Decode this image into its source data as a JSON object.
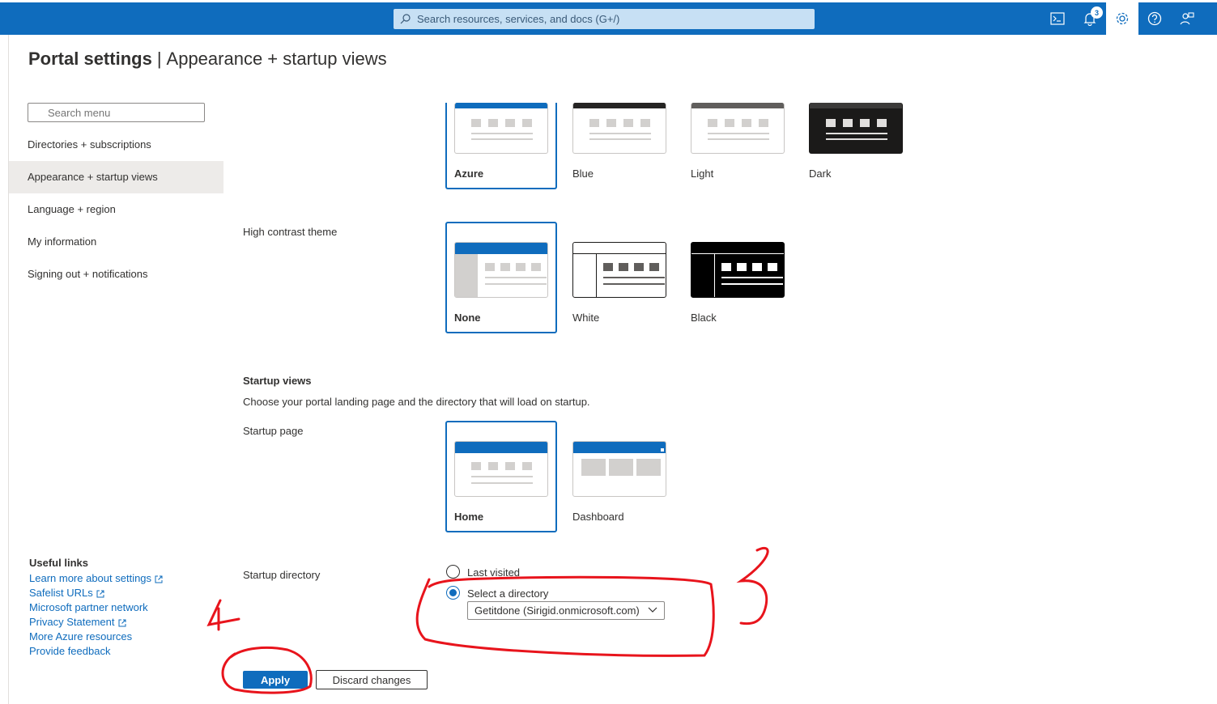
{
  "header": {
    "search_placeholder": "Search resources, services, and docs (G+/)",
    "notification_count": "3",
    "icons": [
      "cloud-shell-icon",
      "bell-icon",
      "gear-icon",
      "help-icon",
      "feedback-icon"
    ]
  },
  "page": {
    "title_bold": "Portal settings",
    "title_separator": "|",
    "title_rest": "Appearance + startup views"
  },
  "menu": {
    "search_placeholder": "Search menu",
    "items": [
      {
        "label": "Directories + subscriptions"
      },
      {
        "label": "Appearance + startup views",
        "selected": true
      },
      {
        "label": "Language + region"
      },
      {
        "label": "My information"
      },
      {
        "label": "Signing out + notifications"
      }
    ]
  },
  "useful_links": {
    "heading": "Useful links",
    "links": [
      "Learn more about settings",
      "Safelist URLs",
      "Microsoft partner network",
      "Privacy Statement",
      "More Azure resources",
      "Provide feedback"
    ]
  },
  "theme": {
    "options": [
      {
        "label": "Azure",
        "selected": true
      },
      {
        "label": "Blue"
      },
      {
        "label": "Light"
      },
      {
        "label": "Dark"
      }
    ]
  },
  "high_contrast": {
    "label": "High contrast theme",
    "options": [
      {
        "label": "None",
        "selected": true
      },
      {
        "label": "White"
      },
      {
        "label": "Black"
      }
    ]
  },
  "startup": {
    "title": "Startup views",
    "description": "Choose your portal landing page and the directory that will load on startup.",
    "page_label": "Startup page",
    "page_options": [
      {
        "label": "Home",
        "selected": true
      },
      {
        "label": "Dashboard"
      }
    ],
    "directory_label": "Startup directory",
    "directory_options": [
      {
        "label": "Last visited",
        "checked": false
      },
      {
        "label": "Select a directory",
        "checked": true
      }
    ],
    "directory_value": "Getitdone (Sirigid.onmicrosoft.com)"
  },
  "actions": {
    "apply": "Apply",
    "discard": "Discard changes"
  },
  "colors": {
    "accent": "#0f6cbd",
    "annotation": "#e8141c"
  }
}
